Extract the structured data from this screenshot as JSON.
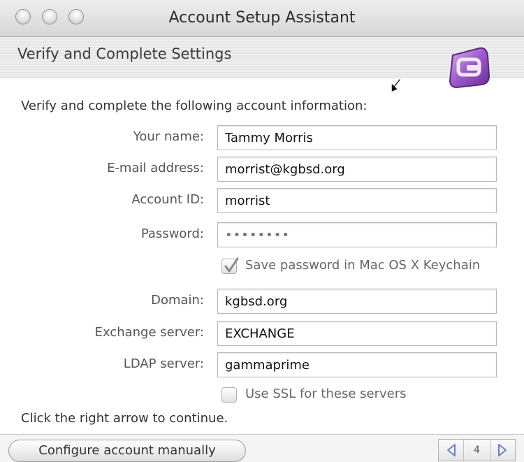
{
  "window": {
    "title": "Account Setup Assistant",
    "header_title": "Verify and Complete Settings",
    "logo_icon": "entourage-logo-icon"
  },
  "form": {
    "intro": "Verify and complete the following account information:",
    "your_name": {
      "label": "Your name:",
      "value": "Tammy Morris"
    },
    "email": {
      "label": "E-mail address:",
      "value": "morrist@kgbsd.org"
    },
    "account_id": {
      "label": "Account ID:",
      "value": "morrist"
    },
    "password": {
      "label": "Password:",
      "value": "••••••••"
    },
    "save_password": {
      "label": "Save password in Mac OS X Keychain",
      "checked": true
    },
    "domain": {
      "label": "Domain:",
      "value": "kgbsd.org"
    },
    "exchange_server": {
      "label": "Exchange server:",
      "value": "EXCHANGE"
    },
    "ldap_server": {
      "label": "LDAP server:",
      "value": "gammaprime"
    },
    "use_ssl": {
      "label": "Use SSL for these servers",
      "checked": false
    },
    "footer_note": "Click the right arrow to continue."
  },
  "bottom": {
    "configure_button": "Configure account manually",
    "page_number": "4"
  },
  "colors": {
    "logo_purple": "#9b59c8",
    "checkmark": "#8a8a8a",
    "pager_arrow": "#6c7fc6"
  }
}
